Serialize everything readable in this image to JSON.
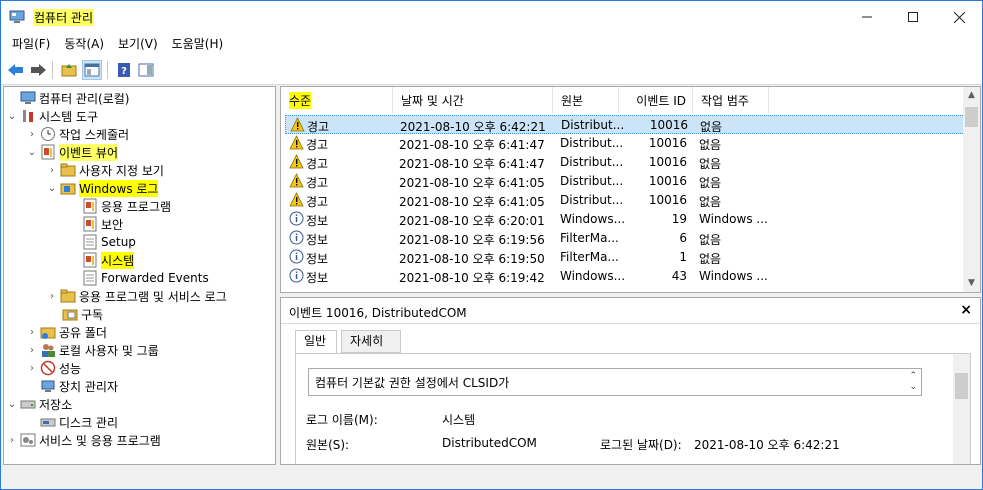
{
  "window": {
    "title": "컴퓨터 관리"
  },
  "menu": [
    "파일(F)",
    "동작(A)",
    "보기(V)",
    "도움말(H)"
  ],
  "tree": {
    "root": "컴퓨터 관리(로컬)",
    "system_tools": "시스템 도구",
    "task_scheduler": "작업 스케줄러",
    "event_viewer": "이벤트 뷰어",
    "custom_views": "사용자 지정 보기",
    "windows_logs": "Windows 로그",
    "app_log": "응용 프로그램",
    "security_log": "보안",
    "setup_log": "Setup",
    "system_log": "시스템",
    "forwarded_events": "Forwarded Events",
    "apps_services_logs": "응용 프로그램 및 서비스 로그",
    "subscriptions": "구독",
    "shared_folders": "공유 폴더",
    "local_users_groups": "로컬 사용자 및 그룹",
    "performance": "성능",
    "device_manager": "장치 관리자",
    "storage": "저장소",
    "disk_management": "디스크 관리",
    "services_apps": "서비스 및 응용 프로그램"
  },
  "columns": {
    "level": "수준",
    "datetime": "날짜 및 시간",
    "source": "원본",
    "event_id": "이벤트 ID",
    "category": "작업 범주"
  },
  "events": [
    {
      "level": "경고",
      "type": "warning",
      "datetime": "2021-08-10 오후 6:42:21",
      "source": "Distribut...",
      "event_id": "10016",
      "category": "없음"
    },
    {
      "level": "경고",
      "type": "warning",
      "datetime": "2021-08-10 오후 6:41:47",
      "source": "Distribut...",
      "event_id": "10016",
      "category": "없음"
    },
    {
      "level": "경고",
      "type": "warning",
      "datetime": "2021-08-10 오후 6:41:47",
      "source": "Distribut...",
      "event_id": "10016",
      "category": "없음"
    },
    {
      "level": "경고",
      "type": "warning",
      "datetime": "2021-08-10 오후 6:41:05",
      "source": "Distribut...",
      "event_id": "10016",
      "category": "없음"
    },
    {
      "level": "경고",
      "type": "warning",
      "datetime": "2021-08-10 오후 6:41:05",
      "source": "Distribut...",
      "event_id": "10016",
      "category": "없음"
    },
    {
      "level": "정보",
      "type": "info",
      "datetime": "2021-08-10 오후 6:20:01",
      "source": "Windows...",
      "event_id": "19",
      "category": "Windows ..."
    },
    {
      "level": "정보",
      "type": "info",
      "datetime": "2021-08-10 오후 6:19:56",
      "source": "FilterMa...",
      "event_id": "6",
      "category": "없음"
    },
    {
      "level": "정보",
      "type": "info",
      "datetime": "2021-08-10 오후 6:19:50",
      "source": "FilterMa...",
      "event_id": "1",
      "category": "없음"
    },
    {
      "level": "정보",
      "type": "info",
      "datetime": "2021-08-10 오후 6:19:42",
      "source": "Windows...",
      "event_id": "43",
      "category": "Windows ..."
    }
  ],
  "detail": {
    "header": "이벤트 10016, DistributedCOM",
    "tabs": [
      "일반",
      "자세히"
    ],
    "description": "컴퓨터 기본값 권한 설정에서 CLSID가",
    "log_name_label": "로그 이름(M):",
    "log_name_value": "시스템",
    "source_label": "원본(S):",
    "source_value": "DistributedCOM",
    "logged_label": "로그된 날짜(D):",
    "logged_value": "2021-08-10 오후 6:42:21"
  },
  "colors": {
    "highlight": "#ffff66",
    "selection": "#cce4f7",
    "border_accent": "#2b79d8"
  }
}
